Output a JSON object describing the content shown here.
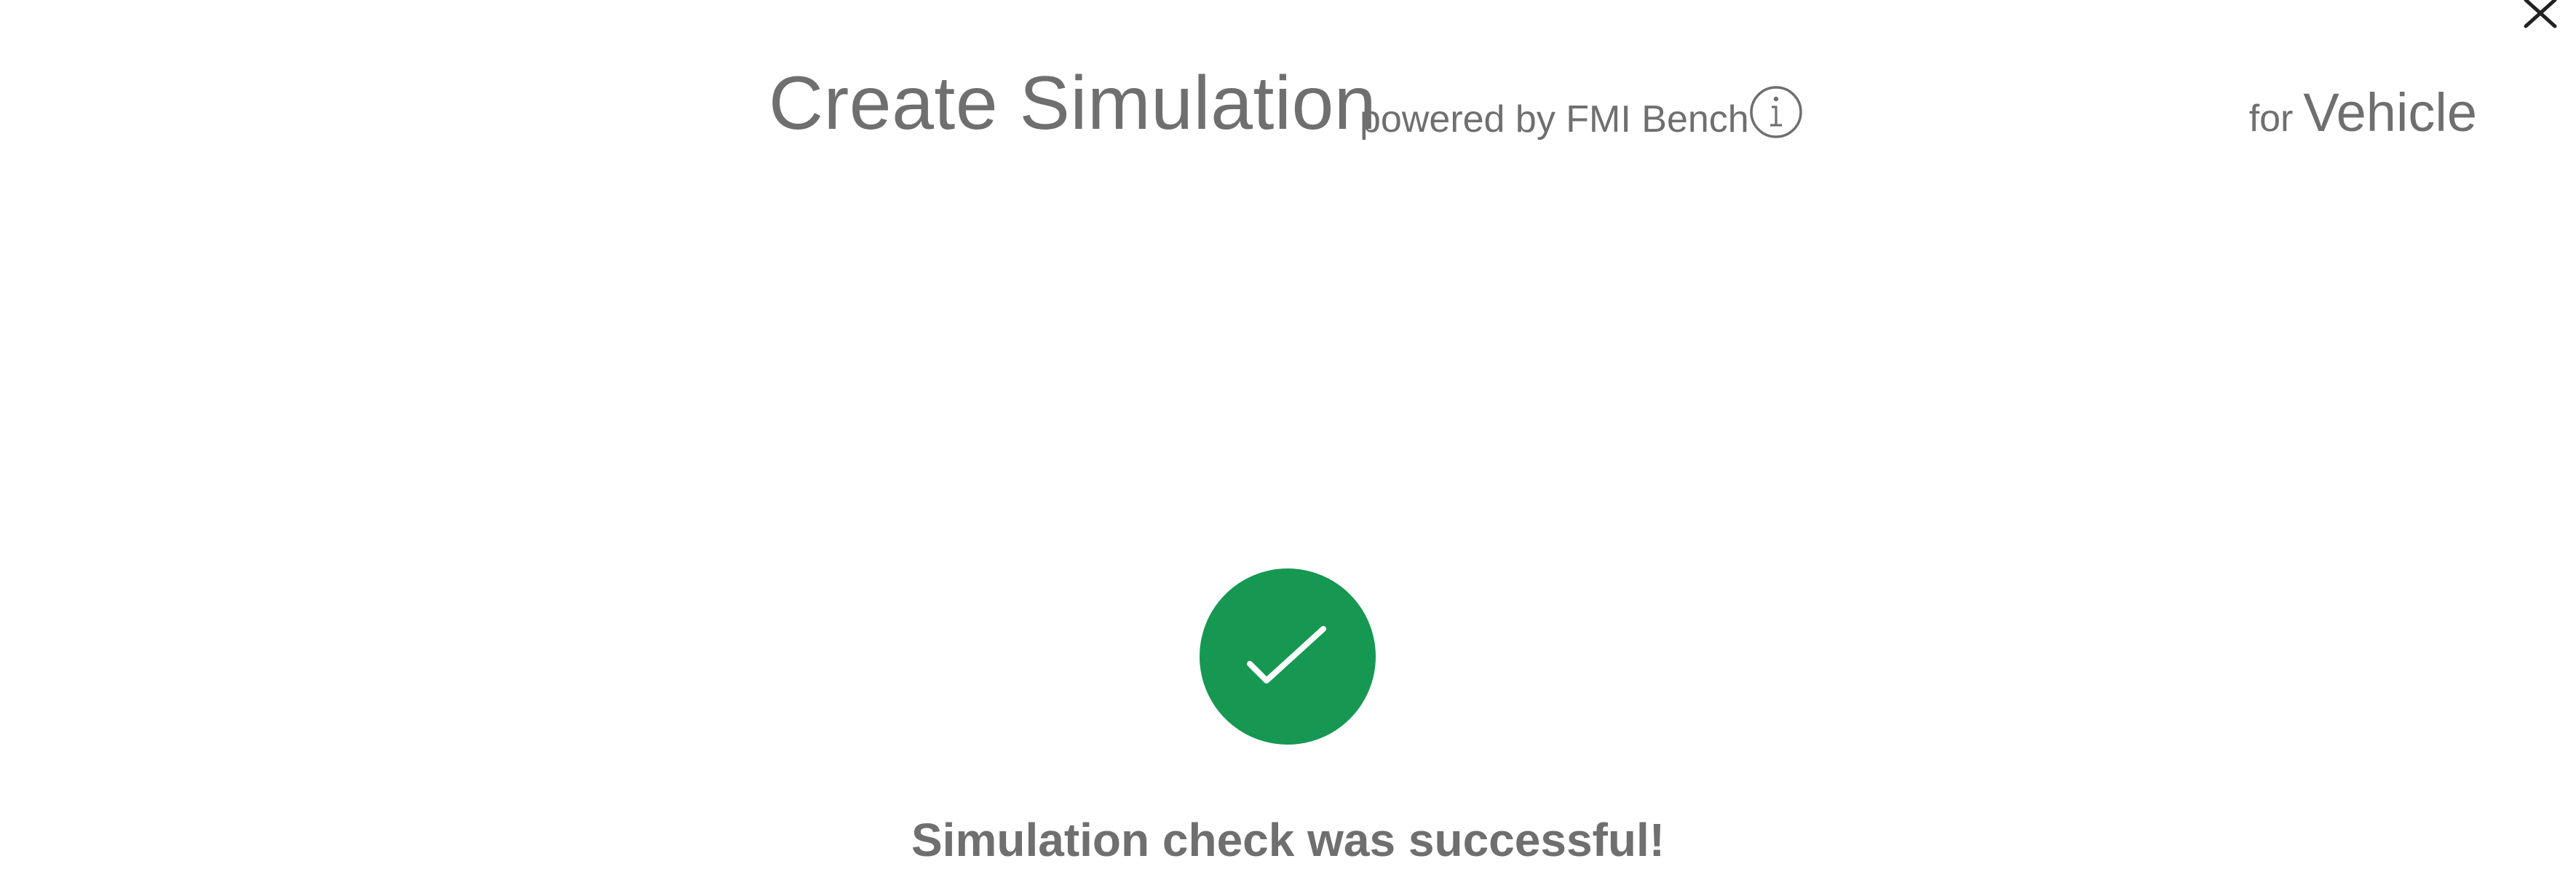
{
  "dialog": {
    "close_icon": "close-icon",
    "title": "Create Simulation",
    "powered_by": "powered by FMI Bench",
    "info_icon": "info-icon",
    "for_label": "for",
    "target_name": "Vehicle"
  },
  "status": {
    "icon": "check-circle-icon",
    "color": "#169752",
    "message": "Simulation check was successful!"
  }
}
